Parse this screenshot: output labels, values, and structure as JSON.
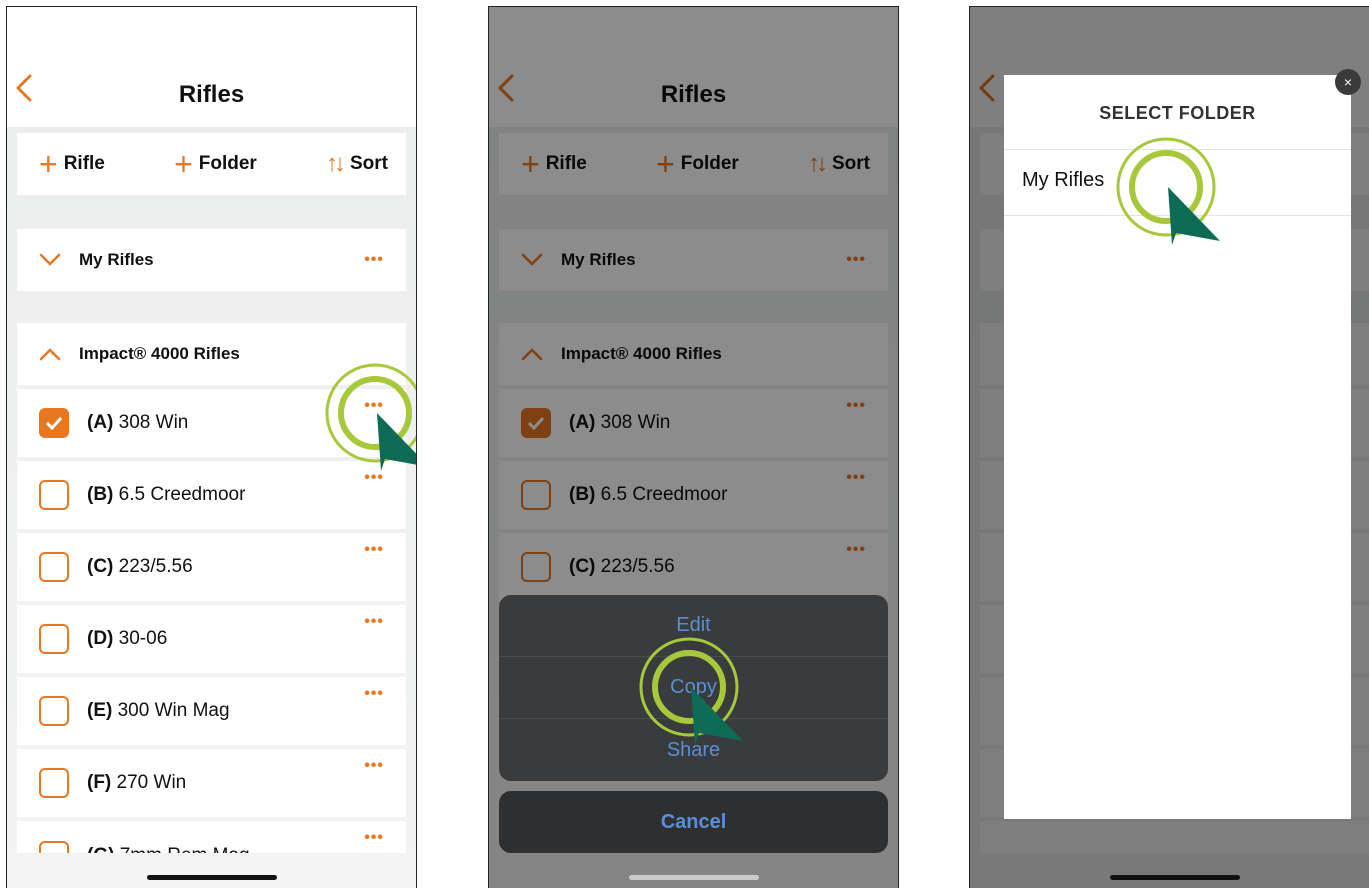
{
  "colors": {
    "accent": "#e87722",
    "cursor_ring": "#a7c83a",
    "cursor_arrow": "#0e6b55",
    "sheet_text": "#5a8fd8"
  },
  "screen": {
    "title": "Rifles",
    "toolbar": {
      "add_rifle": "Rifle",
      "add_folder": "Folder",
      "sort": "Sort"
    },
    "folders": [
      {
        "label": "My Rifles",
        "icon": "chevron-down-icon"
      },
      {
        "label": "Impact® 4000 Rifles",
        "icon": "chevron-up-icon"
      }
    ],
    "rifles": [
      {
        "letter": "(A)",
        "name": "308 Win",
        "checked": true
      },
      {
        "letter": "(B)",
        "name": "6.5 Creedmoor",
        "checked": false
      },
      {
        "letter": "(C)",
        "name": "223/5.56",
        "checked": false
      },
      {
        "letter": "(D)",
        "name": "30-06",
        "checked": false
      },
      {
        "letter": "(E)",
        "name": "300 Win Mag",
        "checked": false
      },
      {
        "letter": "(F)",
        "name": "270 Win",
        "checked": false
      },
      {
        "letter": "(G)",
        "name": "7mm Rem Mag",
        "checked": false
      }
    ],
    "more_label": "•••"
  },
  "action_sheet": {
    "items": [
      "Edit",
      "Copy",
      "Share"
    ],
    "cancel": "Cancel"
  },
  "folder_modal": {
    "title": "SELECT FOLDER",
    "close": "×",
    "items": [
      "My Rifles"
    ]
  }
}
